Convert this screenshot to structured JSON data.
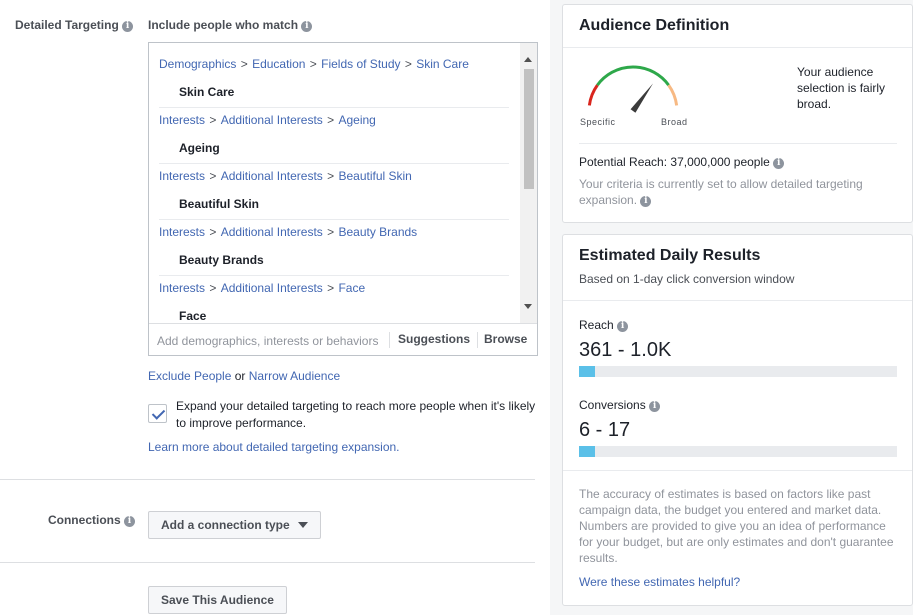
{
  "detailed_targeting": {
    "label": "Detailed Targeting",
    "sub_label": "Include people who match",
    "entries": [
      {
        "path": [
          "Demographics",
          "Education",
          "Fields of Study",
          "Skin Care"
        ],
        "item": "Skin Care"
      },
      {
        "path": [
          "Interests",
          "Additional Interests",
          "Ageing"
        ],
        "item": "Ageing"
      },
      {
        "path": [
          "Interests",
          "Additional Interests",
          "Beautiful Skin"
        ],
        "item": "Beautiful Skin"
      },
      {
        "path": [
          "Interests",
          "Additional Interests",
          "Beauty Brands"
        ],
        "item": "Beauty Brands"
      },
      {
        "path": [
          "Interests",
          "Additional Interests",
          "Face"
        ],
        "item": "Face"
      }
    ],
    "path_separator": ">",
    "input_placeholder": "Add demographics, interests or behaviors",
    "suggestions_label": "Suggestions",
    "browse_label": "Browse",
    "exclude_link": "Exclude People",
    "or_text": "or",
    "narrow_link": "Narrow Audience",
    "expand_checked": true,
    "expand_text": "Expand your detailed targeting to reach more people when it's likely to improve performance.",
    "learn_more": "Learn more about detailed targeting expansion."
  },
  "connections": {
    "label": "Connections",
    "button": "Add a connection type"
  },
  "save_button": "Save This Audience",
  "audience_definition": {
    "title": "Audience Definition",
    "gauge_min_label": "Specific",
    "gauge_max_label": "Broad",
    "gauge_level": 0.7,
    "description": "Your audience selection is fairly broad.",
    "potential_reach": "Potential Reach: 37,000,000 people",
    "note": "Your criteria is currently set to allow detailed targeting expansion."
  },
  "estimated_results": {
    "title": "Estimated Daily Results",
    "subtitle": "Based on 1-day click conversion window",
    "reach_label": "Reach",
    "reach_value": "361 - 1.0K",
    "reach_fill": 0.05,
    "conversions_label": "Conversions",
    "conversions_value": "6 - 17",
    "conversions_fill": 0.05,
    "disclaimer": "The accuracy of estimates is based on factors like past campaign data, the budget you entered and market data. Numbers are provided to give you an idea of performance for your budget, but are only estimates and don't guarantee results.",
    "helpful_link": "Were these estimates helpful?"
  },
  "colors": {
    "link": "#4267b2",
    "bar_fill": "#5bc0e8",
    "gauge_red": "#d9251d",
    "gauge_green": "#2ea84a",
    "gauge_orange": "#f7b983"
  }
}
